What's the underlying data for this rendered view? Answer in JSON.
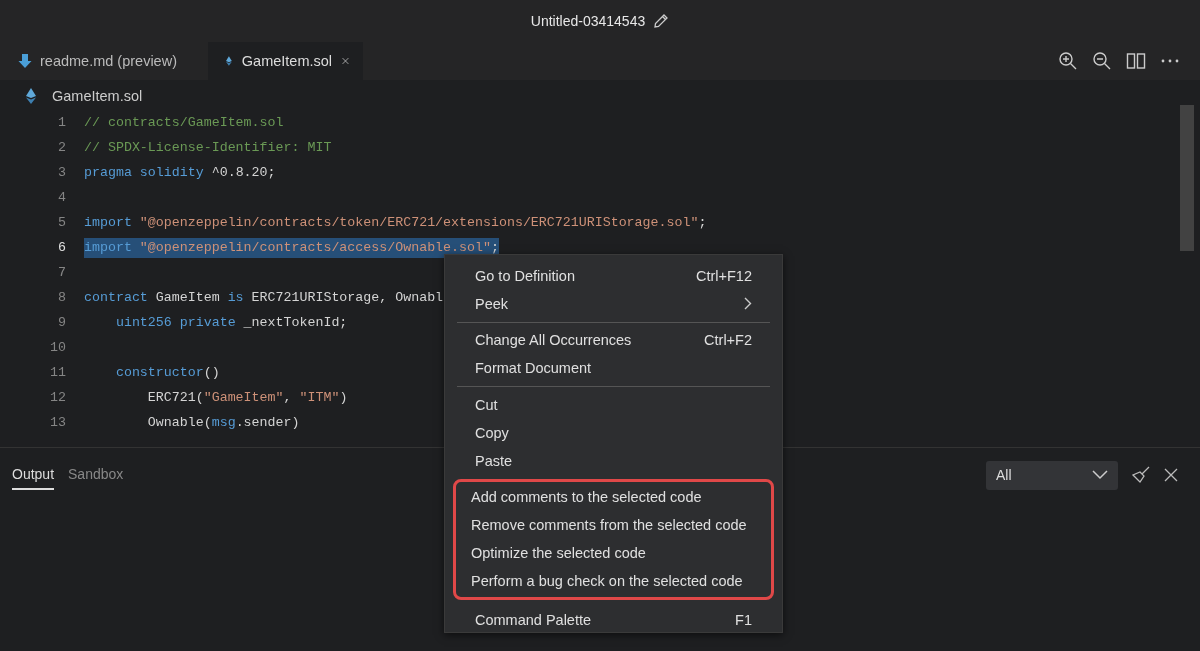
{
  "window": {
    "title": "Untitled-03414543"
  },
  "tabs": [
    {
      "label": "readme.md (preview)",
      "kind": "markdown",
      "selected": false
    },
    {
      "label": "GameItem.sol",
      "kind": "solidity",
      "selected": true
    }
  ],
  "breadcrumb": "GameItem.sol",
  "code": {
    "lines": [
      {
        "number": "1",
        "selected": false,
        "tokens": [
          {
            "kind": "comment",
            "text": "// contracts/GameItem.sol"
          }
        ]
      },
      {
        "number": "2",
        "selected": false,
        "tokens": [
          {
            "kind": "comment",
            "text": "// SPDX-License-Identifier: MIT"
          }
        ]
      },
      {
        "number": "3",
        "selected": false,
        "tokens": [
          {
            "kind": "keyword",
            "text": "pragma"
          },
          {
            "kind": "keyword",
            "text": " solidity"
          },
          {
            "kind": "plain",
            "text": " ^0.8.20;"
          }
        ]
      },
      {
        "number": "4",
        "selected": false
      },
      {
        "number": "5",
        "selected": false,
        "tokens": [
          {
            "kind": "keyword",
            "text": "import"
          },
          {
            "kind": "string",
            "text": " \"@openzeppelin/contracts/token/ERC721/extensions/ERC721URIStorage.sol\""
          },
          {
            "kind": "plain",
            "text": ";"
          }
        ]
      },
      {
        "number": "6",
        "selected": true,
        "tokens": [
          {
            "kind": "keyword",
            "text": "import"
          },
          {
            "kind": "string",
            "text": " \"@openzeppelin/contracts/access/Ownable.sol\""
          },
          {
            "kind": "plain",
            "text": ";"
          }
        ]
      },
      {
        "number": "7",
        "selected": false
      },
      {
        "number": "8",
        "selected": false,
        "tokens": [
          {
            "kind": "keyword",
            "text": "contract"
          },
          {
            "kind": "plain",
            "text": " GameItem "
          },
          {
            "kind": "keyword",
            "text": "is"
          },
          {
            "kind": "plain",
            "text": " ERC721URIStorage, Ownabl"
          }
        ]
      },
      {
        "number": "9",
        "selected": false,
        "tokens": [
          {
            "kind": "keyword",
            "text": "    uint256"
          },
          {
            "kind": "keyword",
            "text": " private"
          },
          {
            "kind": "plain",
            "text": " _nextTokenId;"
          }
        ]
      },
      {
        "number": "10",
        "selected": false
      },
      {
        "number": "11",
        "selected": false,
        "tokens": [
          {
            "kind": "keyword",
            "text": "    constructor"
          },
          {
            "kind": "plain",
            "text": "()"
          }
        ]
      },
      {
        "number": "12",
        "selected": false,
        "tokens": [
          {
            "kind": "plain",
            "text": "        ERC721("
          },
          {
            "kind": "string",
            "text": "\"GameItem\""
          },
          {
            "kind": "plain",
            "text": ", "
          },
          {
            "kind": "string",
            "text": "\"ITM\""
          },
          {
            "kind": "plain",
            "text": ")"
          }
        ]
      },
      {
        "number": "13",
        "selected": false,
        "tokens": [
          {
            "kind": "plain",
            "text": "        Ownable("
          },
          {
            "kind": "keyword",
            "text": "msg"
          },
          {
            "kind": "plain",
            "text": ".sender)"
          }
        ]
      }
    ]
  },
  "panel": {
    "tabs": [
      {
        "label": "Output",
        "selected": true
      },
      {
        "label": "Sandbox",
        "selected": false
      }
    ],
    "filter": "All"
  },
  "context_menu": {
    "sections": [
      {
        "items": [
          {
            "label": "Go to Definition",
            "shortcut": "Ctrl+F12"
          },
          {
            "label": "Peek",
            "submenu": true
          }
        ]
      },
      {
        "items": [
          {
            "label": "Change All Occurrences",
            "shortcut": "Ctrl+F2"
          },
          {
            "label": "Format Document"
          }
        ]
      },
      {
        "items": [
          {
            "label": "Cut"
          },
          {
            "label": "Copy"
          },
          {
            "label": "Paste"
          }
        ]
      },
      {
        "highlighted": true,
        "items": [
          {
            "label": "Add comments to the selected code"
          },
          {
            "label": "Remove comments from the selected code"
          },
          {
            "label": "Optimize the selected code"
          },
          {
            "label": "Perform a bug check on the selected code"
          }
        ]
      },
      {
        "items": [
          {
            "label": "Command Palette",
            "shortcut": "F1"
          }
        ]
      }
    ]
  }
}
